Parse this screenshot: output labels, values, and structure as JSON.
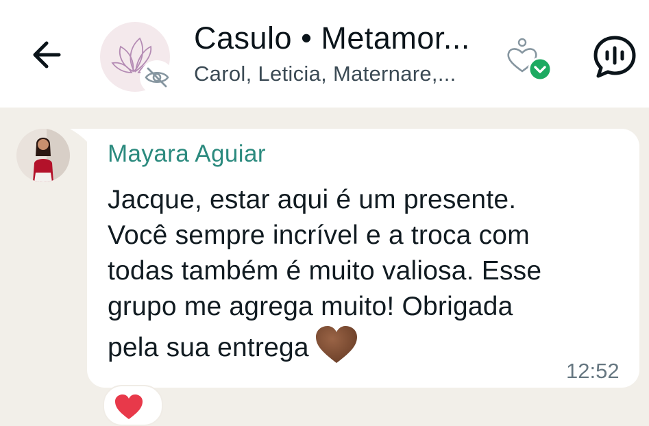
{
  "header": {
    "title": "Casulo • Metamor...",
    "subtitle": "Carol, Leticia, Maternare,...",
    "icons": {
      "back": "arrow-left-icon",
      "avatar": "lotus-logo",
      "hidden_badge": "eye-off-icon",
      "community": "community-icon",
      "voice_chat": "voice-chat-icon"
    }
  },
  "message": {
    "sender": "Mayara Aguiar",
    "lines": [
      "Jacque, estar aqui é um presente.",
      "Você sempre incrível e a troca com",
      "todas também é muito valiosa. Esse",
      "grupo me agrega muito! Obrigada",
      "pela sua entrega"
    ],
    "emoji": "brown-heart",
    "time": "12:52",
    "reaction": "red-heart"
  },
  "colors": {
    "header_bg": "#ffffff",
    "chat_bg": "#f2efe9",
    "sender_name": "#2b8a7e",
    "accent_green": "#1daa61",
    "time": "#667781"
  }
}
